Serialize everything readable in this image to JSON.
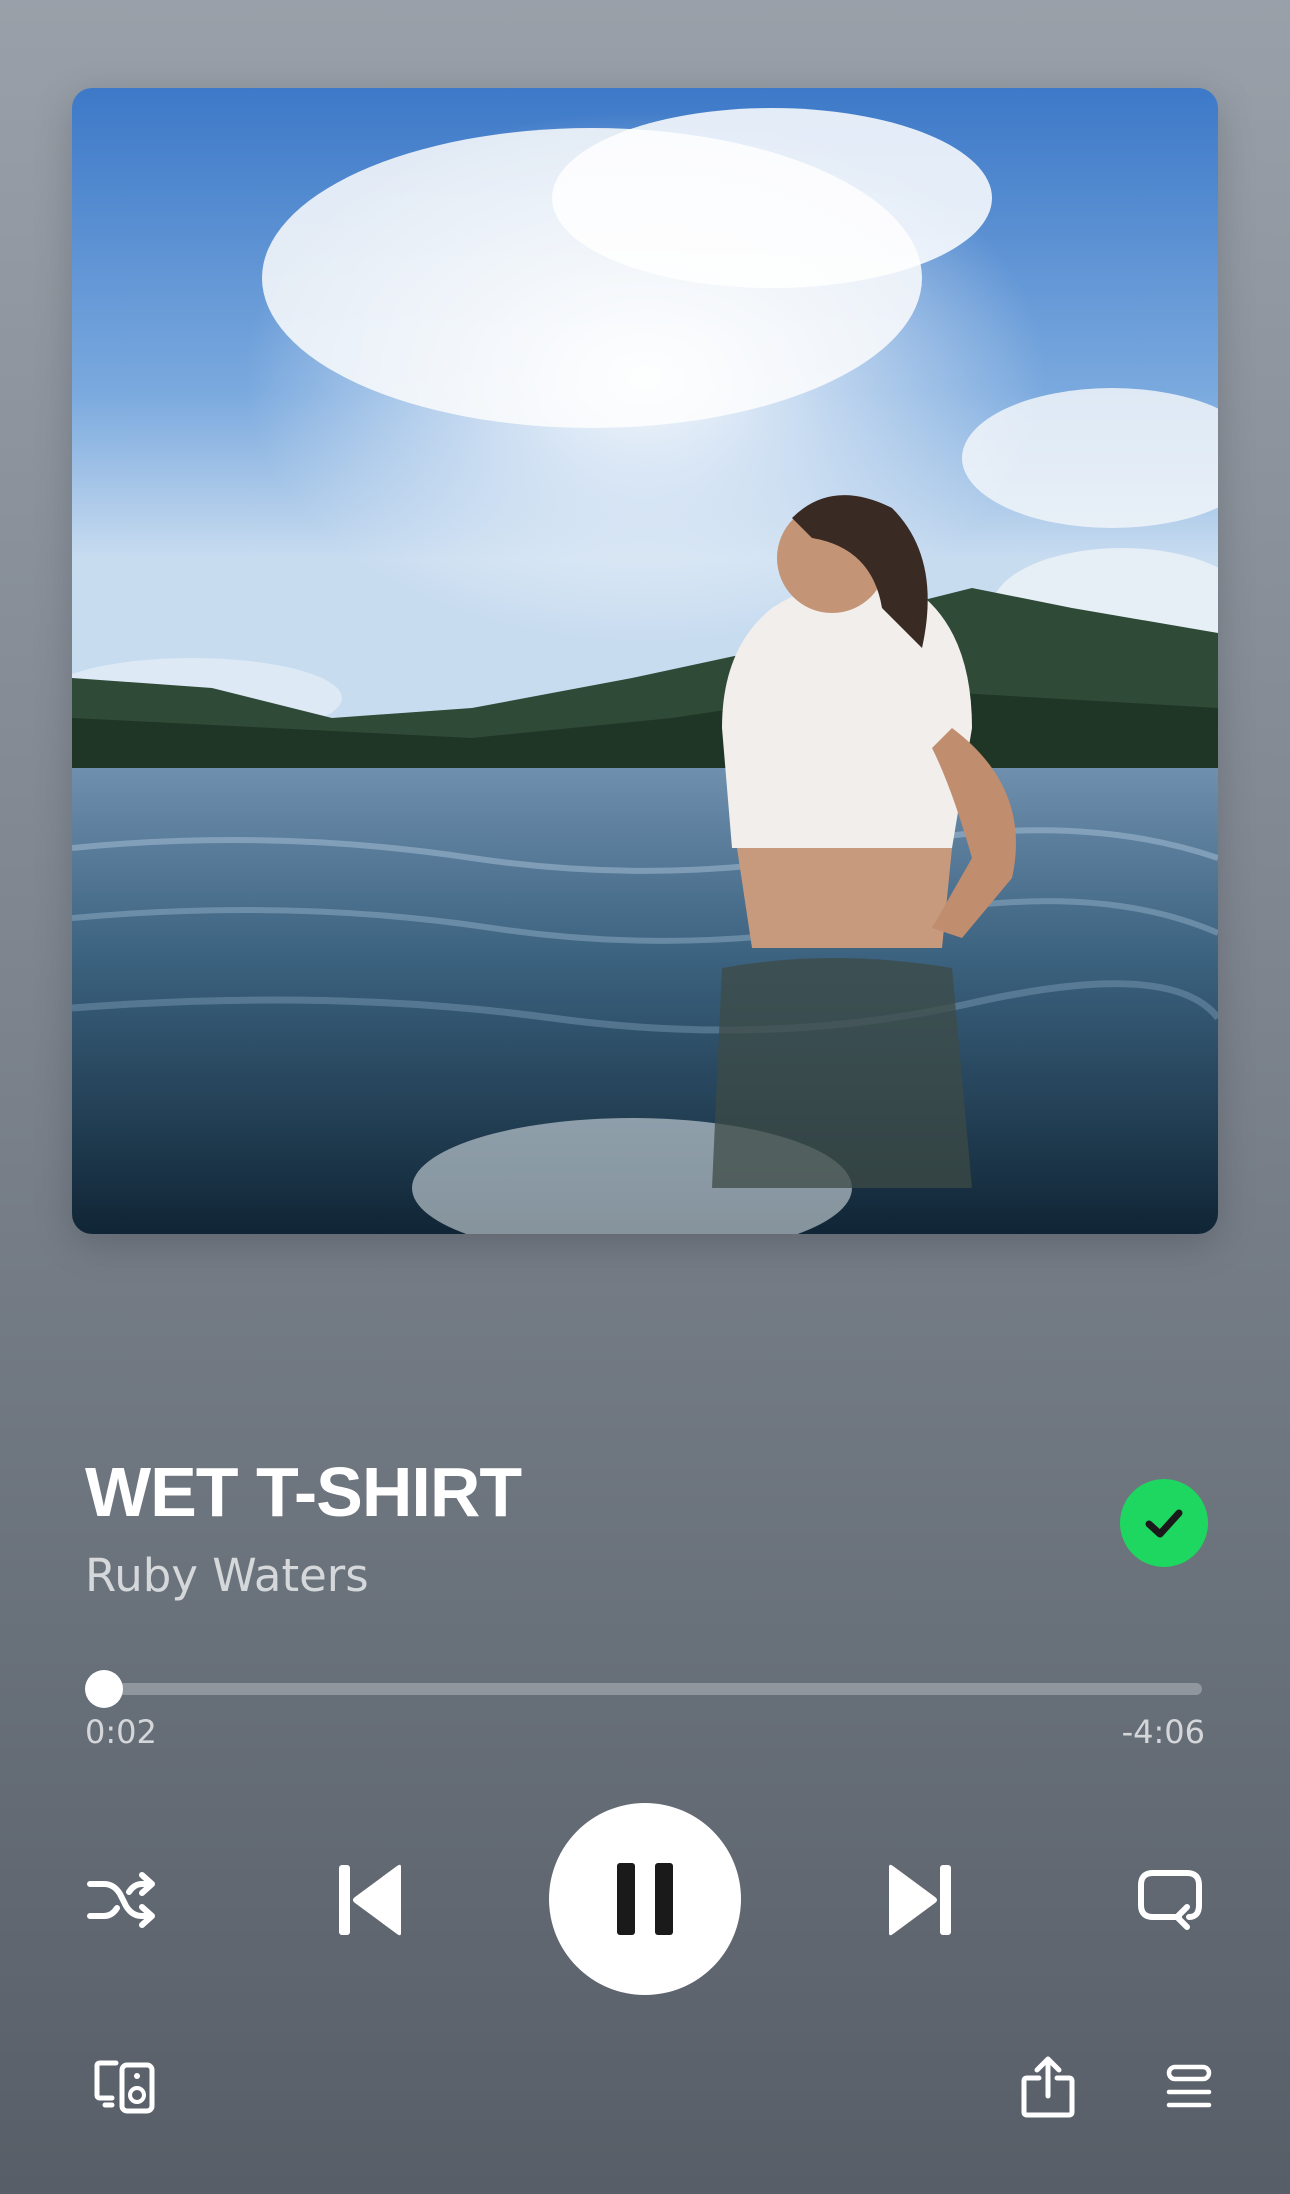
{
  "now_playing": {
    "title": "WET T-SHIRT",
    "artist": "Ruby Waters",
    "liked": true,
    "artwork_icon": "album-cover-woman-in-lake"
  },
  "playback": {
    "elapsed": "0:02",
    "remaining": "-4:06",
    "progress_fraction": 0.008,
    "state": "playing"
  },
  "controls": {
    "icons": [
      "shuffle-icon",
      "previous-icon",
      "pause-icon",
      "next-icon",
      "repeat-icon"
    ]
  },
  "footer": {
    "icons": [
      "connect-devices-icon",
      "share-icon",
      "queue-icon"
    ]
  },
  "colors": {
    "accent": "#1ed760",
    "background_top": "#99a0a9",
    "background_bottom": "#585e67"
  }
}
